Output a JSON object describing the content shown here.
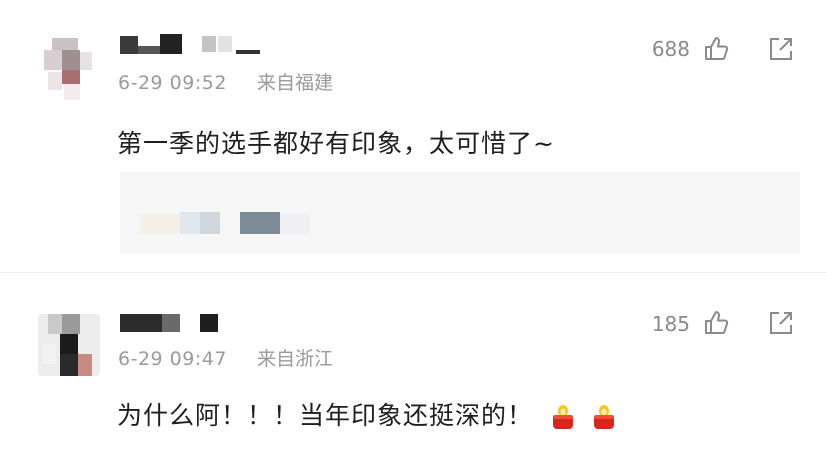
{
  "comments": [
    {
      "time": "6-29 09:52",
      "location": "来自福建",
      "likes": "688",
      "text": "第一季的选手都好有印象，太可惜了~",
      "has_quoted_preview": true
    },
    {
      "time": "6-29 09:47",
      "location": "来自浙江",
      "likes": "185",
      "text": "为什么阿！！！当年印象还挺深的！",
      "emojis": [
        "candle-icon",
        "candle-icon"
      ]
    }
  ],
  "colors": {
    "meta_text": "#9a9a9a",
    "body_text": "#1e1e1e",
    "icon": "#8a8a8a",
    "quote_bg": "#f6f6f6"
  }
}
